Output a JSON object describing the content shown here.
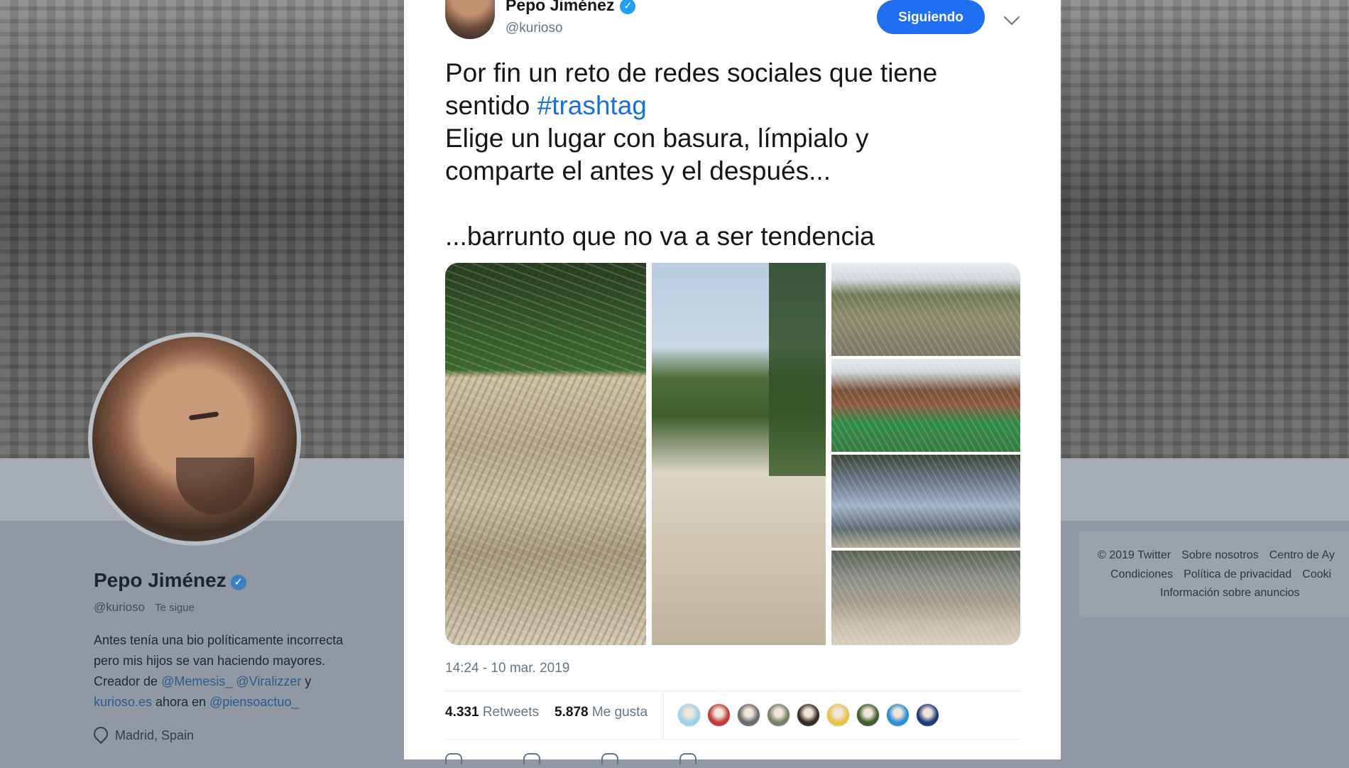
{
  "profile": {
    "name": "Pepo Jiménez",
    "verified_mark": "✓",
    "handle": "@kurioso",
    "follows_you": "Te sigue",
    "bio_1": "Antes tenía una bio políticamente incorrecta",
    "bio_2": "pero mis hijos se van haciendo mayores.",
    "bio_3a": "Creador de ",
    "bio_3b": "@Memesis_",
    "bio_3c": " ",
    "bio_3d": "@Viralizzer",
    "bio_3e": " y",
    "bio_4a": "kurioso.es",
    "bio_4b": " ahora en ",
    "bio_4c": "@piensoactuo_",
    "location": "Madrid, Spain"
  },
  "footer": {
    "row1": [
      "© 2019 Twitter",
      "Sobre nosotros",
      "Centro de Ay"
    ],
    "row2": [
      "Condiciones",
      "Política de privacidad",
      "Cooki"
    ],
    "row3": "Información sobre anuncios"
  },
  "tweet": {
    "author_name": "Pepo Jiménez",
    "verified_mark": "✓",
    "author_handle": "@kurioso",
    "follow_label": "Siguiendo",
    "text_line1a": "Por fin un reto de redes sociales que tiene",
    "text_line2a": "sentido ",
    "hashtag": "#trashtag",
    "text_line3": "Elige un lugar con basura, límpialo y",
    "text_line4": "comparte el antes y el después...",
    "text_line5": "...barrunto que no va a ser tendencia",
    "timestamp": "14:24 - 10 mar. 2019",
    "retweets_count": "4.331",
    "retweets_label": "Retweets",
    "likes_count": "5.878",
    "likes_label": "Me gusta"
  },
  "colors": {
    "follow_button": "#1f6ff0",
    "hashtag": "#1b6fd9",
    "verified": "#1da1f2"
  },
  "likers": [
    "#9fd0ea",
    "#c23b3b",
    "#6b6b6b",
    "#7a7f6a",
    "#3a2c22",
    "#e8c34a",
    "#3f5e2a",
    "#2b8fcf",
    "#223a7a"
  ]
}
